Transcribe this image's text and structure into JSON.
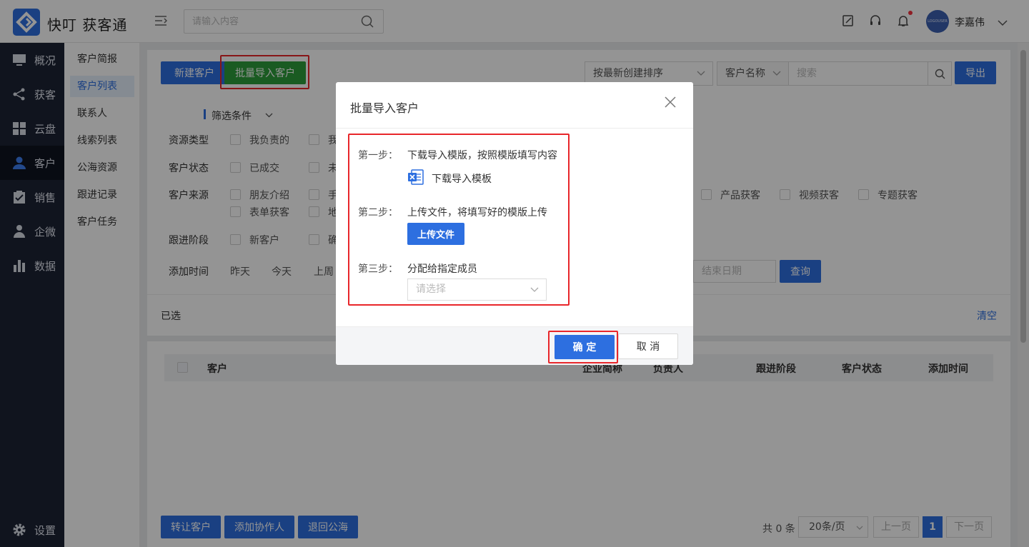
{
  "app": {
    "brand": "快叮 获客通"
  },
  "topbar": {
    "search_placeholder": "请输入内容",
    "user_name": "李嘉伟",
    "avatar_text": "LOGOUSER"
  },
  "sidebar": {
    "items": [
      {
        "label": "概况",
        "icon": "monitor-icon"
      },
      {
        "label": "获客",
        "icon": "share-icon"
      },
      {
        "label": "云盘",
        "icon": "grid-icon"
      },
      {
        "label": "客户",
        "icon": "user-icon",
        "active": true
      },
      {
        "label": "销售",
        "icon": "clipboard-check-icon"
      },
      {
        "label": "企微",
        "icon": "person-icon"
      },
      {
        "label": "数据",
        "icon": "bar-chart-icon"
      }
    ],
    "settings": "设置"
  },
  "subnav": {
    "items": [
      "客户简报",
      "客户列表",
      "联系人",
      "线索列表",
      "公海资源",
      "跟进记录",
      "客户任务"
    ],
    "active_index": 1
  },
  "toolbar": {
    "new_customer": "新建客户",
    "batch_import": "批量导入客户",
    "sort_select": "按最新创建排序",
    "field_select": "客户名称",
    "search_placeholder": "搜索",
    "export": "导出"
  },
  "filters": {
    "title": "筛选条件",
    "rows": [
      {
        "label": "资源类型",
        "options": [
          "我负责的",
          "我"
        ]
      },
      {
        "label": "客户状态",
        "options": [
          "已成交",
          "未"
        ]
      },
      {
        "label": "客户来源",
        "options": [
          "朋友介绍",
          "手",
          "产品获客",
          "视频获客",
          "专题获客"
        ],
        "options_row2": [
          "表单获客",
          "地"
        ]
      },
      {
        "label": "跟进阶段",
        "options": [
          "新客户",
          "确"
        ]
      }
    ],
    "time_label": "添加时间",
    "time_options": [
      "昨天",
      "今天",
      "上周"
    ],
    "end_date_placeholder": "结束日期",
    "query": "查询"
  },
  "selected": {
    "label": "已选",
    "clear": "清空"
  },
  "table": {
    "headers": [
      "客户",
      "企业简称",
      "负责人",
      "跟进阶段",
      "客户状态",
      "添加时间"
    ]
  },
  "bottom": {
    "transfer": "转让客户",
    "add_collab": "添加协作人",
    "return_pool": "退回公海",
    "total": "共 0 条",
    "page_size": "20条/页",
    "prev": "上一页",
    "page": "1",
    "next": "下一页"
  },
  "modal": {
    "title": "批量导入客户",
    "steps": [
      {
        "label": "第一步：",
        "text": "下载导入模版，按照模版填写内容",
        "action": "下载导入模板"
      },
      {
        "label": "第二步：",
        "text": "上传文件，将填写好的模版上传",
        "action": "上传文件"
      },
      {
        "label": "第三步：",
        "text": "分配给指定成员",
        "placeholder": "请选择"
      }
    ],
    "confirm": "确 定",
    "cancel": "取 消"
  },
  "colors": {
    "primary": "#2d6fe0",
    "green": "#2e9d3c",
    "sidebar": "#1d2335",
    "highlight": "#e8262a"
  }
}
